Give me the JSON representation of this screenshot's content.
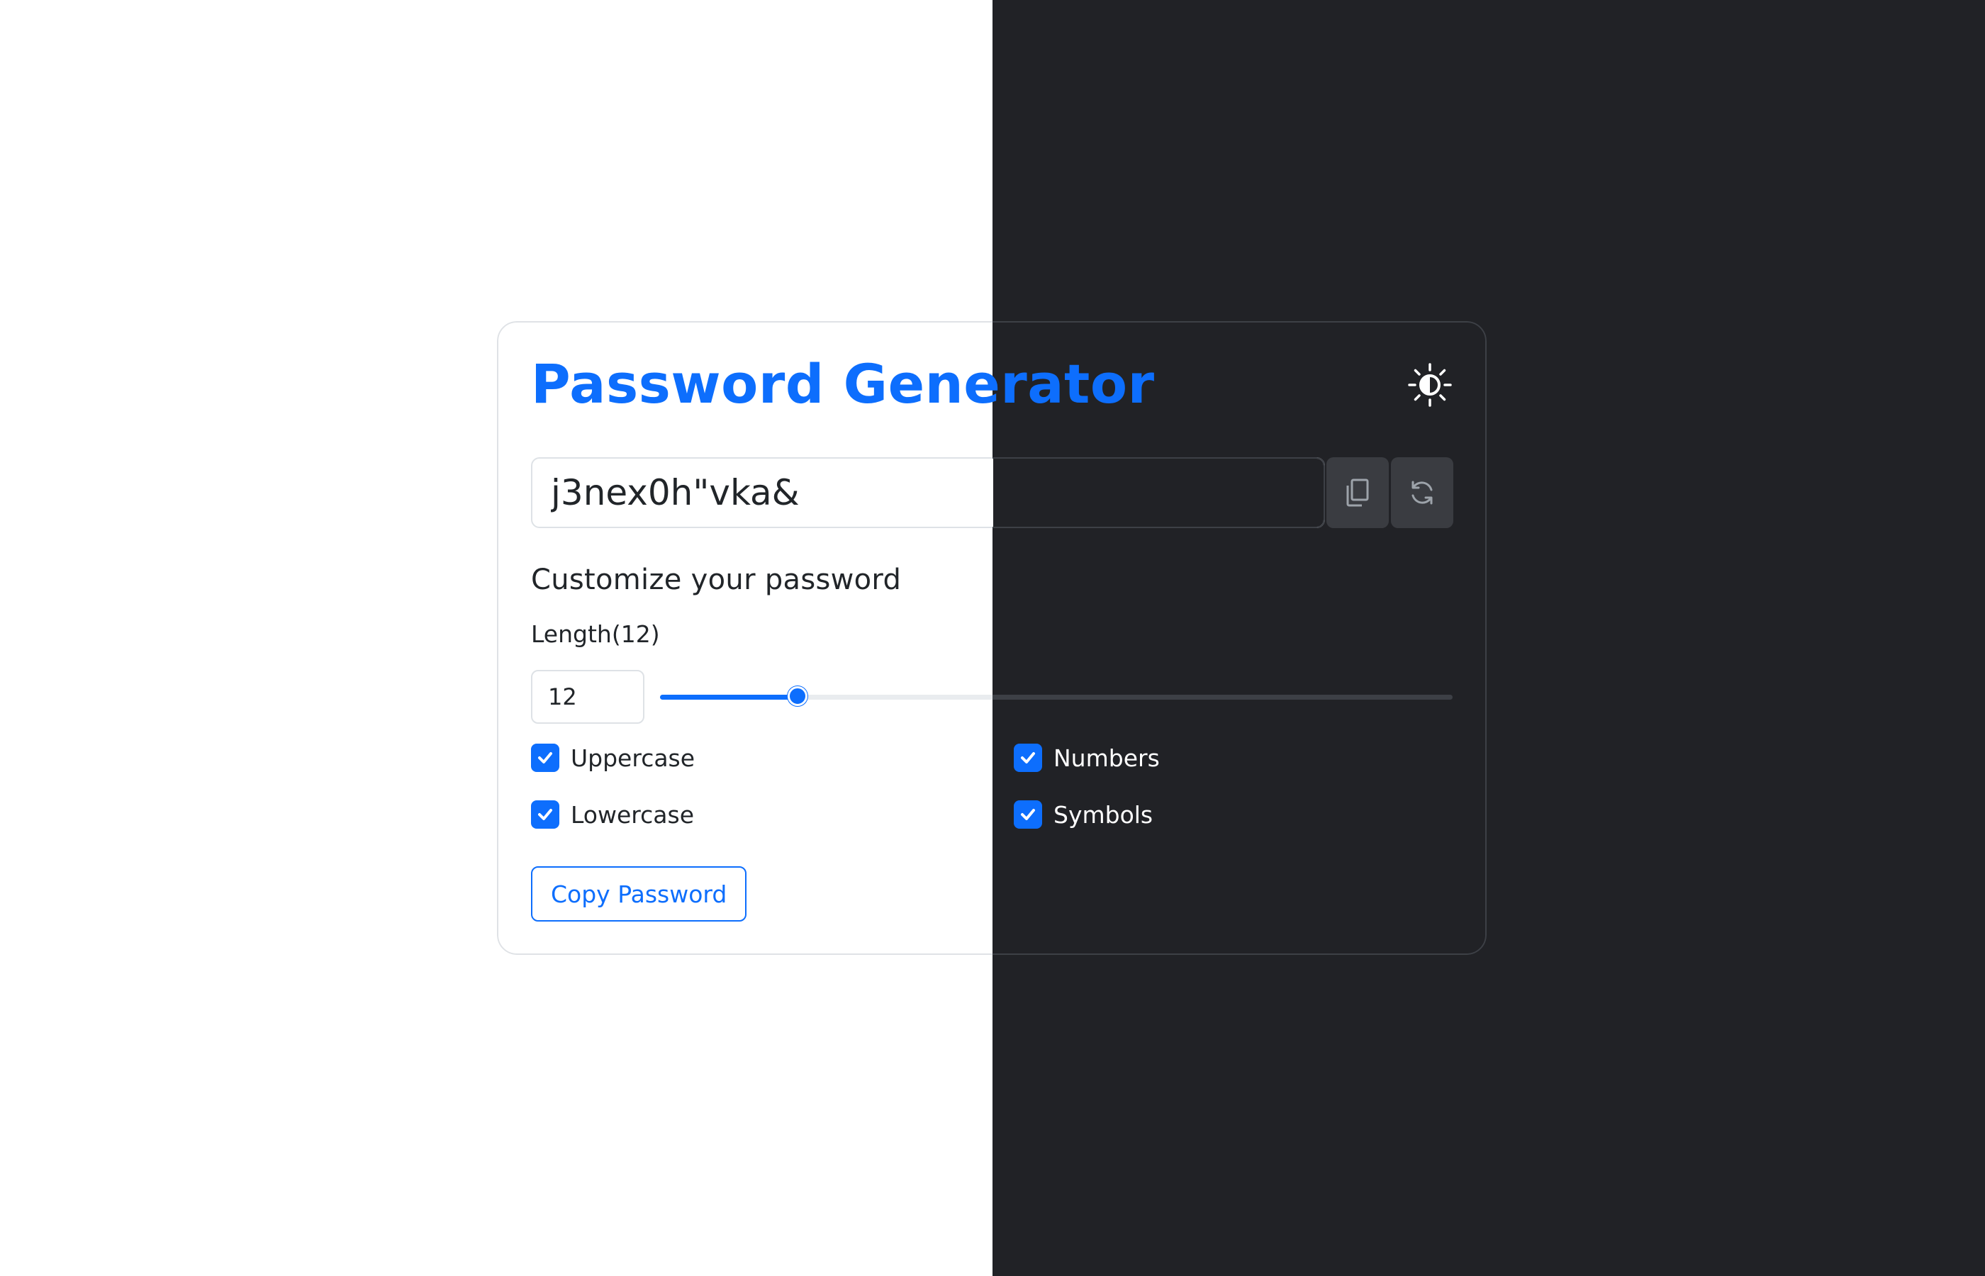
{
  "app": {
    "title": "Password Generator",
    "theme_toggle_icon": "contrast-sun-icon"
  },
  "password": {
    "value": "j3nex0h\"vka&",
    "copy_icon": "copy-icon",
    "refresh_icon": "refresh-icon"
  },
  "customize": {
    "heading": "Customize your password",
    "length_label": "Length(12)",
    "length_value": "12",
    "length_min": 4,
    "length_max": 50
  },
  "options": [
    {
      "label": "Uppercase",
      "checked": true
    },
    {
      "label": "Lowercase",
      "checked": true
    },
    {
      "label": "Numbers",
      "checked": true
    },
    {
      "label": "Symbols",
      "checked": true
    }
  ],
  "actions": {
    "copy_password_label": "Copy Password"
  },
  "colors": {
    "accent": "#0d6efd",
    "dark_bg": "#212226",
    "light_bg": "#ffffff"
  }
}
